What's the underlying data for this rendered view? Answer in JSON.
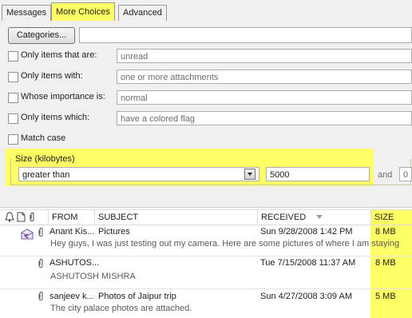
{
  "tabs": [
    "Messages",
    "More Choices",
    "Advanced"
  ],
  "categories_button": "Categories...",
  "categories_value": "",
  "options": [
    {
      "label": "Only items that are:",
      "value": "unread",
      "checked": false
    },
    {
      "label": "Only items with:",
      "value": "one or more attachments",
      "checked": false
    },
    {
      "label": "Whose importance is:",
      "value": "normal",
      "checked": false
    },
    {
      "label": "Only items which:",
      "value": "have a colored flag",
      "checked": false
    }
  ],
  "match_case_label": "Match case",
  "size": {
    "label": "Size (kilobytes)",
    "operator": "greater than",
    "value1": "5000",
    "and_label": "and",
    "value2": "0"
  },
  "list": {
    "columns": [
      "FROM",
      "SUBJECT",
      "RECEIVED",
      "SIZE"
    ],
    "rows": [
      {
        "from": "Anant Kis...",
        "subject": "Pictures",
        "received": "Sun 9/28/2008 1:42 PM",
        "size": "8 MB",
        "preview": "Hey guys,  I was just testing out my camera. Here are some pictures of where I am staying"
      },
      {
        "from": "ASHUTOS...",
        "subject": "",
        "received": "Tue 7/15/2008 11:37 AM",
        "size": "8 MB",
        "preview": "ASHUTOSH  MISHRA"
      },
      {
        "from": "sanjeev k...",
        "subject": "Photos of Jaipur trip",
        "received": "Sun 4/27/2008 3:09 AM",
        "size": "5 MB",
        "preview": "The city palace photos are attached."
      }
    ]
  },
  "colors": {
    "highlight": "#ffff66",
    "panel": "#f0f0f0"
  }
}
